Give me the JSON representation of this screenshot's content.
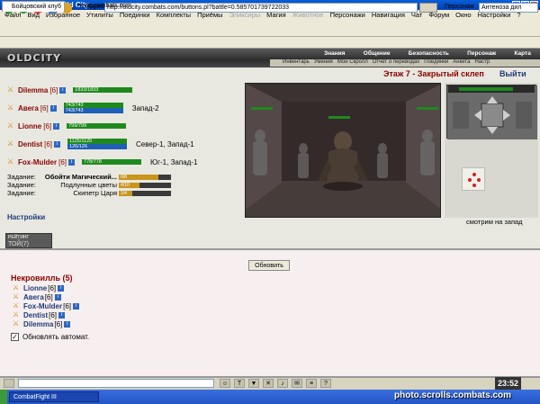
{
  "window": {
    "title": "CombatFight III - Old City"
  },
  "menu": [
    "Файл",
    "Вид",
    "Избранное",
    "Утилиты",
    "Поединки",
    "Комплекты",
    "Приёмы",
    "Эликсиры",
    "Магия",
    "Животное",
    "Персонажи",
    "Навигация",
    "Чат",
    "Форум",
    "Окно",
    "Настройки",
    "?"
  ],
  "address": {
    "label": "Адрес",
    "url": "http://oldcity.combats.com/buttons.pl?battle=0.585701739722033",
    "person_label": "Персонаж",
    "person_value": "Антеноза дил"
  },
  "tabs": [
    {
      "label": "Бойцовский клуб"
    },
    {
      "label": "news.combats.com"
    }
  ],
  "game": {
    "logo": "OLDCITY",
    "topnav": [
      "Знания",
      "Общение",
      "Безопасность",
      "Персонаж",
      "Карта"
    ],
    "subnav": [
      "Инвентарь",
      "Умения",
      "Мой Скролл",
      "Отчет о переводах",
      "Поединки",
      "Анкета",
      "Настр"
    ],
    "floor_title": "Этаж 7 - Закрытый склеп",
    "exit_label": "Выйти",
    "look_message": "смотрим на запад",
    "settings_label": "Настройки",
    "rating": {
      "title": "РЕЙТИНГ",
      "value": "ТОЙ(7)"
    },
    "players": [
      {
        "name": "Dilemma",
        "level": "[6]",
        "hp": "1833/1833",
        "mp": "",
        "loc": ""
      },
      {
        "name": "Авега",
        "level": "[6]",
        "hp": "743/743",
        "mp": "743/743",
        "loc": "Запад-2"
      },
      {
        "name": "Lionne",
        "level": "[6]",
        "hp": "799/799",
        "mp": "",
        "loc": ""
      },
      {
        "name": "Dentist",
        "level": "[6]",
        "hp": "1125/1125",
        "mp": "126/126",
        "loc": "Север-1, Запад-1"
      },
      {
        "name": "Fox-Mulder",
        "level": "[6]",
        "hp": "778/778",
        "mp": "",
        "loc": "Юг-1, Запад-1"
      }
    ],
    "tasks": [
      {
        "label": "Задание:",
        "name": "Обойти Магический...",
        "progress": "6/8",
        "frac": 0.75
      },
      {
        "label": "Задание:",
        "name": "Подлунные цветы",
        "progress": "4/10",
        "frac": 0.4
      },
      {
        "label": "Задание:",
        "name": "Скипетр Царя",
        "progress": "1/4",
        "frac": 0.25
      }
    ]
  },
  "room": {
    "refresh_label": "Обновить",
    "title": "Некровилль (5)",
    "members": [
      {
        "name": "Lionne",
        "level": "[6]"
      },
      {
        "name": "Авега",
        "level": "[6]"
      },
      {
        "name": "Fox-Mulder",
        "level": "[6]"
      },
      {
        "name": "Dentist",
        "level": "[6]"
      },
      {
        "name": "Dilemma",
        "level": "[6]"
      }
    ],
    "autorefresh_label": "Обновлять автомат."
  },
  "chat": {
    "clock": "23:52"
  },
  "taskbar": {
    "item": "CombatFight III"
  },
  "watermark": "photo.scrolls.combats.com",
  "colors": {
    "hp": "#1e8a1e",
    "mp": "#1f5fb5",
    "name": "#8b0000",
    "link": "#1e3c78"
  }
}
